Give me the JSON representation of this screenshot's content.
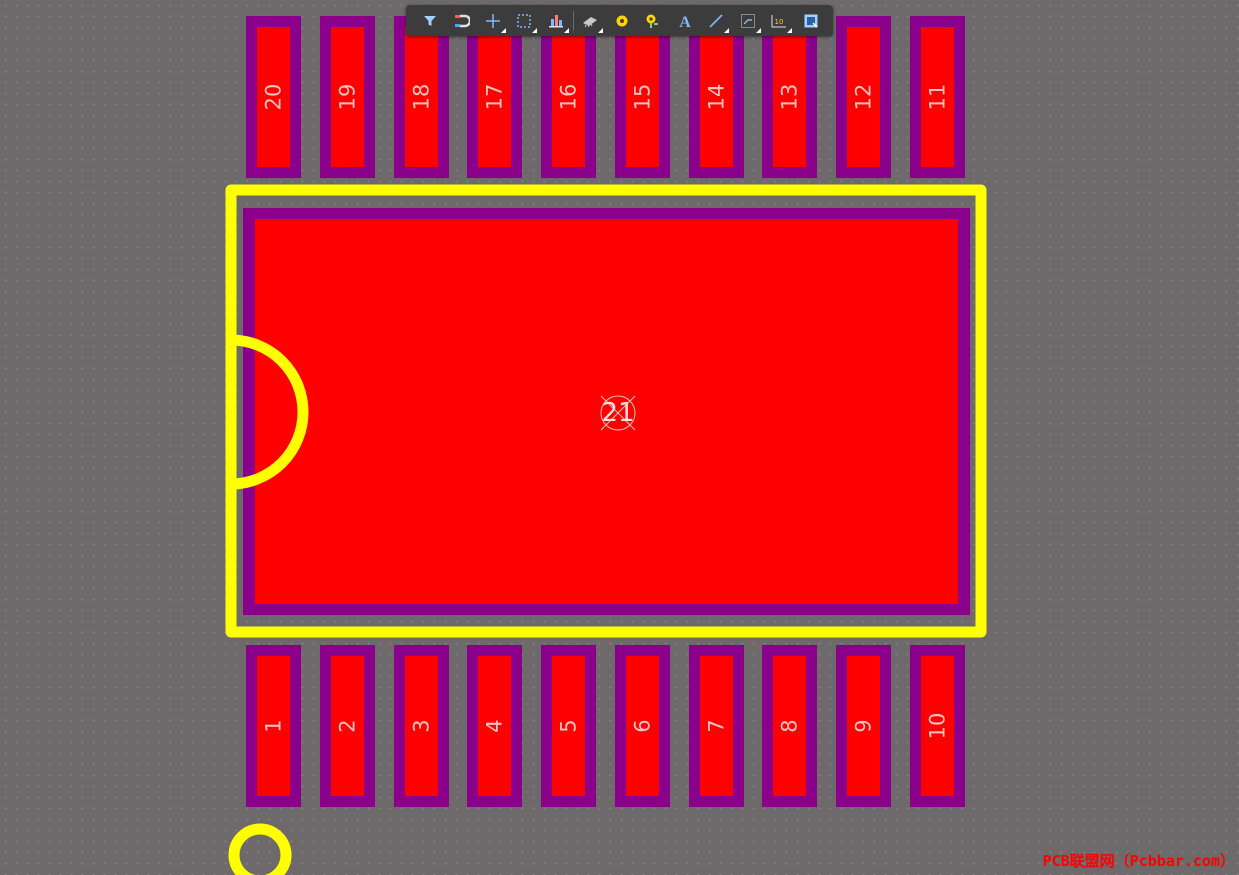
{
  "pads_top": [
    "20",
    "19",
    "18",
    "17",
    "16",
    "15",
    "14",
    "13",
    "12",
    "11"
  ],
  "pads_bottom": [
    "1",
    "2",
    "3",
    "4",
    "5",
    "6",
    "7",
    "8",
    "9",
    "10"
  ],
  "thermal_pad": {
    "label": "21"
  },
  "colors": {
    "board": "#6e6a6b",
    "copper": "#ff0000",
    "solder_mask": "#8b008b",
    "silkscreen": "#ffff00",
    "pad_text": "#ffc2c2",
    "toolbar": "#3c3c3c"
  },
  "toolbar": {
    "buttons": [
      {
        "icon": "filter-icon"
      },
      {
        "icon": "snap-magnet-icon"
      },
      {
        "icon": "crosshair-icon"
      },
      {
        "icon": "select-rect-icon"
      },
      {
        "icon": "align-icon"
      },
      {
        "icon": "component-icon"
      },
      {
        "icon": "pad-icon"
      },
      {
        "icon": "via-icon"
      },
      {
        "icon": "text-icon"
      },
      {
        "icon": "line-icon"
      },
      {
        "icon": "route-icon"
      },
      {
        "icon": "dimension-icon"
      },
      {
        "icon": "region-icon"
      }
    ]
  },
  "watermark": "PCB联盟网（Pcbbar.com）"
}
